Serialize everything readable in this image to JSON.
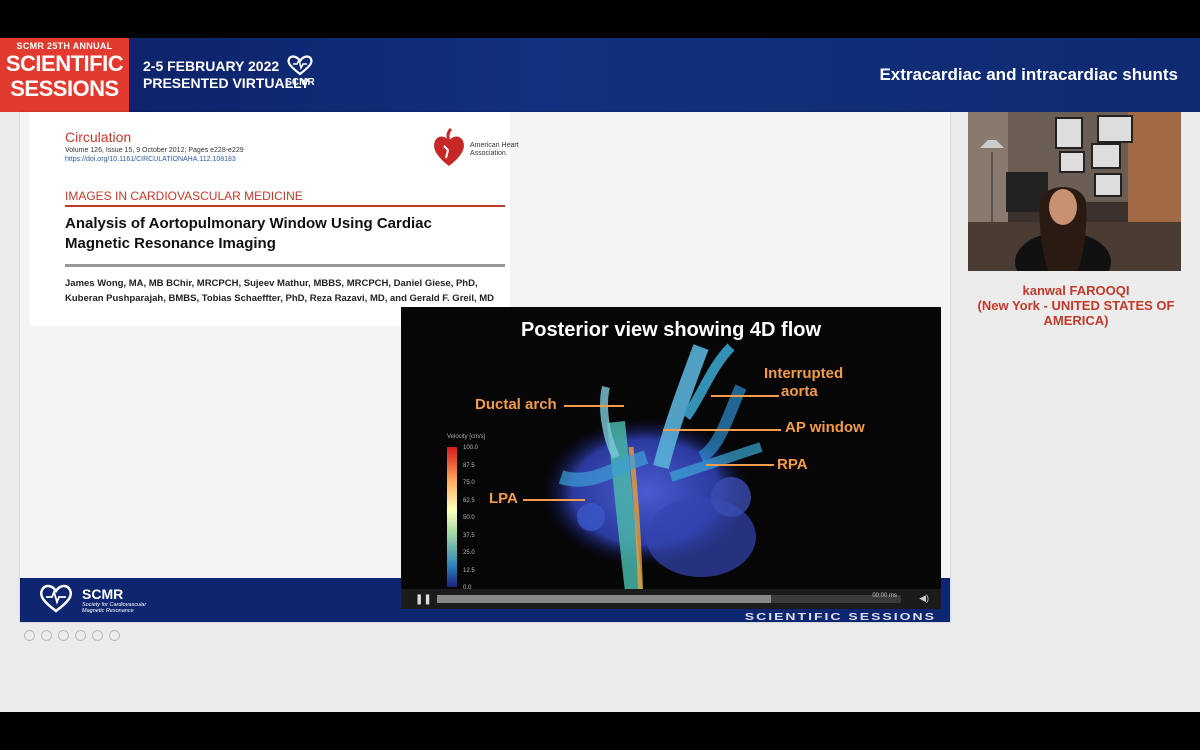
{
  "header": {
    "brand_small": "SCMR 25TH ANNUAL",
    "brand_line1": "SCIENTIFIC",
    "brand_line2": "SESSIONS",
    "date": "2-5 FEBRUARY 2022",
    "mode": "PRESENTED VIRTUALLY",
    "logo_label": "SCMR",
    "session_title": "Extracardiac and intracardiac shunts"
  },
  "paper": {
    "journal": "Circulation",
    "volume": "Volume 126, Issue 15, 9 October 2012; Pages e228-e229",
    "doi": "https://doi.org/10.1161/CIRCULATIONAHA.112.108183",
    "publisher": "American Heart Association.",
    "section": "IMAGES IN CARDIOVASCULAR MEDICINE",
    "title": "Analysis of Aortopulmonary Window Using Cardiac Magnetic Resonance Imaging",
    "authors": "James Wong, MA, MB BChir, MRCPCH, Sujeev Mathur, MBBS, MRCPCH, Daniel Giese, PhD, Kuberan Pushparajah, BMBS, Tobias Schaeffter, PhD, Reza Razavi, MD, and Gerald F. Greil, MD"
  },
  "slide_footer": {
    "logo_title": "SCMR",
    "logo_subtitle": "Society for Cardiovascular Magnetic Resonance",
    "right_text": "SCIENTIFIC SESSIONS"
  },
  "video": {
    "title": "Posterior view showing 4D flow",
    "labels": {
      "interrupted": "Interrupted",
      "aorta": "aorta",
      "ductal": "Ductal arch",
      "ap_window": "AP window",
      "rpa": "RPA",
      "lpa": "LPA"
    },
    "scale_title": "Velocity [cm/s]",
    "scale_ticks": [
      "100.0",
      "87.5",
      "75.0",
      "62.5",
      "50.0",
      "37.5",
      "25.0",
      "12.5",
      "0.0"
    ],
    "time": "00:00 ms",
    "progress": 0.72
  },
  "speaker": {
    "name": "kanwal FAROOQI",
    "location": "(New York - UNITED STATES OF AMERICA)"
  },
  "colors": {
    "header_blue": "#12307d",
    "brand_red": "#e23a2e",
    "label_orange": "#f39c4b",
    "speaker_red": "#c0392b"
  }
}
